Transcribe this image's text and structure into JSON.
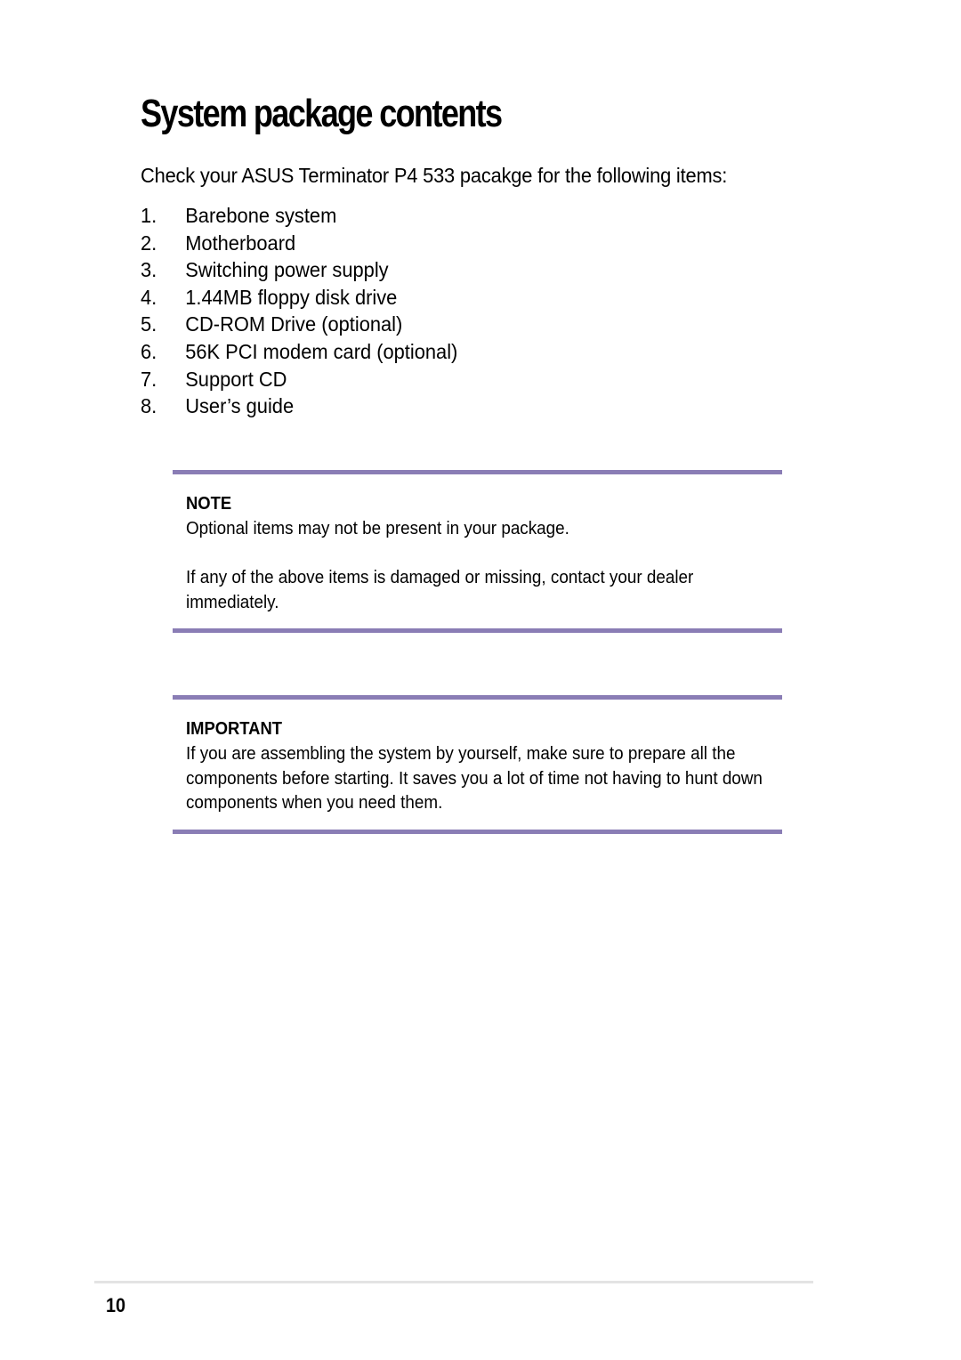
{
  "page": {
    "title": "System package contents",
    "intro": "Check your ASUS Terminator P4 533 pacakge for the following items:",
    "items": [
      {
        "number": "1.",
        "label": "Barebone system"
      },
      {
        "number": "2.",
        "label": "Motherboard"
      },
      {
        "number": "3.",
        "label": "Switching power supply"
      },
      {
        "number": "4.",
        "label": "1.44MB floppy disk drive"
      },
      {
        "number": "5.",
        "label": "CD-ROM Drive (optional)"
      },
      {
        "number": "6.",
        "label": "56K PCI modem card (optional)"
      },
      {
        "number": "7.",
        "label": "Support CD"
      },
      {
        "number": "8.",
        "label": "User’s guide"
      }
    ],
    "note": {
      "label": "NOTE",
      "paragraphs": [
        "Optional items may not be present in your package.",
        "If any of the above items is damaged or missing, contact your dealer immediately."
      ]
    },
    "important": {
      "label": "IMPORTANT",
      "paragraphs": [
        "If you are assembling the system by yourself, make sure to prepare all the components before starting. It saves you a lot of time not having to hunt down components when you need them."
      ]
    },
    "page_number": "10"
  },
  "colors": {
    "callout_rule": "#8a7db5",
    "footer_rule": "#e3e3e3",
    "text": "#000000"
  }
}
